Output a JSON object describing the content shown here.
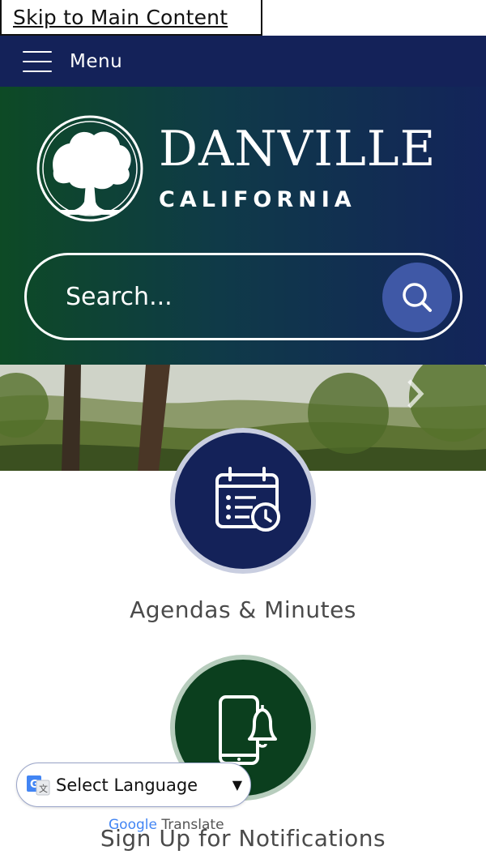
{
  "skip_link": "Skip to Main Content",
  "menu": {
    "label": "Menu"
  },
  "brand": {
    "name": "DANVILLE",
    "state": "CALIFORNIA",
    "header_colors": [
      "#0d4a25",
      "#13245a"
    ]
  },
  "search": {
    "placeholder": "Search..."
  },
  "tiles": [
    {
      "label": "Agendas & Minutes",
      "icon": "calendar-clock-icon",
      "color": "#142259"
    },
    {
      "label": "Sign Up for Notifications",
      "icon": "phone-bell-icon",
      "color": "#0b3f1e"
    }
  ],
  "translate": {
    "label": "Select Language",
    "powered_prefix": "Google",
    "powered_suffix": "Translate"
  }
}
